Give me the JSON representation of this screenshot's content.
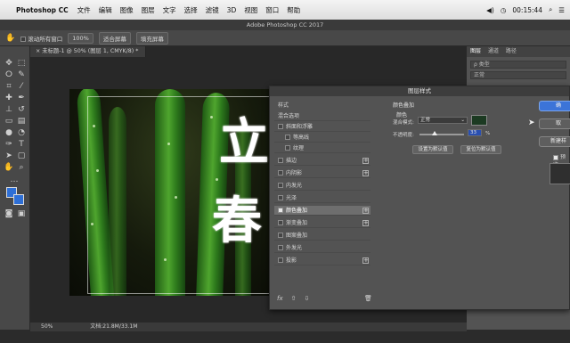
{
  "menubar": {
    "app_name": "Photoshop CC",
    "items": [
      "文件",
      "编辑",
      "图像",
      "图层",
      "文字",
      "选择",
      "滤镜",
      "3D",
      "视图",
      "窗口",
      "帮助"
    ],
    "time": "00:15:44",
    "status_icons": [
      "volume-icon",
      "clock-icon",
      "menu-icon"
    ]
  },
  "window": {
    "title": "Adobe Photoshop CC 2017"
  },
  "options_bar": {
    "scroll_all_windows": "滚动所有窗口",
    "zoom_100": "100%",
    "fit_screen": "适合屏幕",
    "fill_screen": "填充屏幕"
  },
  "document": {
    "tab_label": "未标题-1 @ 50% (图层 1, CMYK/8) *",
    "poster_chars": [
      "立",
      "春"
    ],
    "zoom": "50%",
    "doc_info": "文档:21.8M/33.1M"
  },
  "right_panel": {
    "tabs": [
      "图层",
      "通道",
      "路径"
    ],
    "rows": [
      "ρ 类型",
      "正常"
    ]
  },
  "dialog": {
    "title": "图层样式",
    "styles_header": "样式",
    "blend_options": "混合选项",
    "style_items": [
      {
        "label": "斜面和浮雕",
        "checked": false,
        "plus": false
      },
      {
        "label": "等高线",
        "checked": false,
        "plus": false
      },
      {
        "label": "纹理",
        "checked": false,
        "plus": false
      },
      {
        "label": "描边",
        "checked": false,
        "plus": true
      },
      {
        "label": "内阴影",
        "checked": false,
        "plus": true
      },
      {
        "label": "内发光",
        "checked": false,
        "plus": false
      },
      {
        "label": "光泽",
        "checked": false,
        "plus": false
      },
      {
        "label": "颜色叠加",
        "checked": true,
        "plus": true
      },
      {
        "label": "渐变叠加",
        "checked": false,
        "plus": true
      },
      {
        "label": "图案叠加",
        "checked": false,
        "plus": false
      },
      {
        "label": "外发光",
        "checked": false,
        "plus": false
      },
      {
        "label": "投影",
        "checked": false,
        "plus": true
      }
    ],
    "footer_fx": "fx",
    "section_title": "颜色叠加",
    "section_sub": "颜色",
    "blend_mode_label": "混合模式:",
    "blend_mode_value": "正常",
    "overlay_color": "#1c3a22",
    "opacity_label": "不透明度:",
    "opacity_value": "33",
    "opacity_unit": "%",
    "opacity_fraction": 0.33,
    "set_default": "设置为默认值",
    "reset_default": "复位为默认值",
    "buttons": [
      "确",
      "取",
      "新建样"
    ],
    "preview_label": "预览"
  }
}
